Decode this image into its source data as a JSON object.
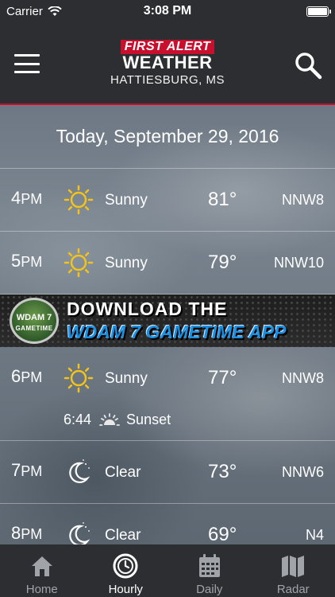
{
  "status_bar": {
    "carrier": "Carrier",
    "time": "3:08 PM",
    "battery_level": 1.0
  },
  "header": {
    "logo_top": "FIRST ALERT",
    "logo_bottom": "WEATHER",
    "location": "HATTIESBURG, MS",
    "accent_color": "#c8102e"
  },
  "date_heading": "Today, September 29, 2016",
  "hours": [
    {
      "hour": "4",
      "ampm": "PM",
      "icon": "sun-icon",
      "condition": "Sunny",
      "temp": "81°",
      "wind": "NNW8"
    },
    {
      "hour": "5",
      "ampm": "PM",
      "icon": "sun-icon",
      "condition": "Sunny",
      "temp": "79°",
      "wind": "NNW10"
    },
    {
      "hour": "6",
      "ampm": "PM",
      "icon": "sun-icon",
      "condition": "Sunny",
      "temp": "77°",
      "wind": "NNW8"
    },
    {
      "hour": "7",
      "ampm": "PM",
      "icon": "moon-icon",
      "condition": "Clear",
      "temp": "73°",
      "wind": "NNW6"
    },
    {
      "hour": "8",
      "ampm": "PM",
      "icon": "moon-icon",
      "condition": "Clear",
      "temp": "69°",
      "wind": "N4"
    }
  ],
  "sunset": {
    "time": "6:44",
    "label": "Sunset"
  },
  "ad": {
    "badge_text": "WDAM 7",
    "badge_sub": "GAMETIME",
    "line1": "DOWNLOAD THE",
    "line2": "WDAM 7 GAMETIME APP"
  },
  "tabs": [
    {
      "label": "Home",
      "icon": "home-icon",
      "active": false
    },
    {
      "label": "Hourly",
      "icon": "clock-icon",
      "active": true
    },
    {
      "label": "Daily",
      "icon": "calendar-icon",
      "active": false
    },
    {
      "label": "Radar",
      "icon": "map-icon",
      "active": false
    }
  ]
}
